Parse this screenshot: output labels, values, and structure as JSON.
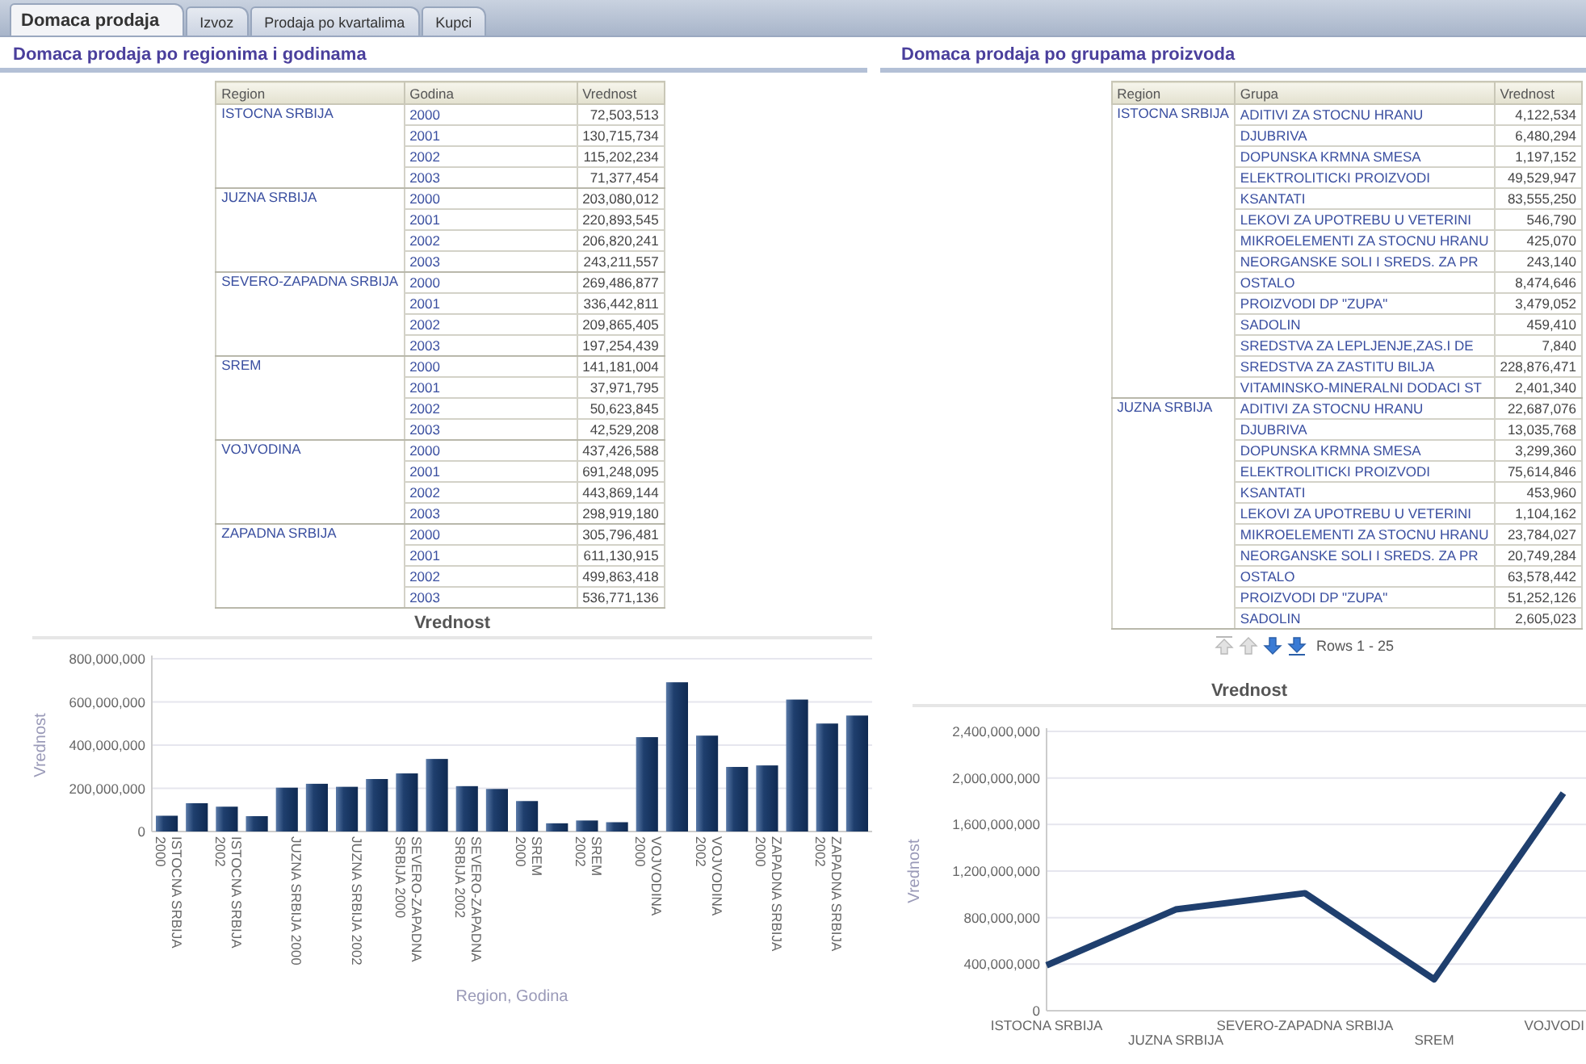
{
  "tabs": [
    {
      "label": "Domaca prodaja",
      "selected": true
    },
    {
      "label": "Izvoz",
      "selected": false
    },
    {
      "label": "Prodaja po kvartalima",
      "selected": false
    },
    {
      "label": "Kupci",
      "selected": false
    }
  ],
  "left": {
    "title": "Domaca prodaja po regionima i godinama",
    "table": {
      "columns": [
        "Region",
        "Godina",
        "Vrednost"
      ],
      "groups": [
        {
          "region": "ISTOCNA SRBIJA",
          "rows": [
            [
              "2000",
              "72,503,513"
            ],
            [
              "2001",
              "130,715,734"
            ],
            [
              "2002",
              "115,202,234"
            ],
            [
              "2003",
              "71,377,454"
            ]
          ]
        },
        {
          "region": "JUZNA SRBIJA",
          "rows": [
            [
              "2000",
              "203,080,012"
            ],
            [
              "2001",
              "220,893,545"
            ],
            [
              "2002",
              "206,820,241"
            ],
            [
              "2003",
              "243,211,557"
            ]
          ]
        },
        {
          "region": "SEVERO-ZAPADNA SRBIJA",
          "rows": [
            [
              "2000",
              "269,486,877"
            ],
            [
              "2001",
              "336,442,811"
            ],
            [
              "2002",
              "209,865,405"
            ],
            [
              "2003",
              "197,254,439"
            ]
          ]
        },
        {
          "region": "SREM",
          "rows": [
            [
              "2000",
              "141,181,004"
            ],
            [
              "2001",
              "37,971,795"
            ],
            [
              "2002",
              "50,623,845"
            ],
            [
              "2003",
              "42,529,208"
            ]
          ]
        },
        {
          "region": "VOJVODINA",
          "rows": [
            [
              "2000",
              "437,426,588"
            ],
            [
              "2001",
              "691,248,095"
            ],
            [
              "2002",
              "443,869,144"
            ],
            [
              "2003",
              "298,919,180"
            ]
          ]
        },
        {
          "region": "ZAPADNA SRBIJA",
          "rows": [
            [
              "2000",
              "305,796,481"
            ],
            [
              "2001",
              "611,130,915"
            ],
            [
              "2002",
              "499,863,418"
            ],
            [
              "2003",
              "536,771,136"
            ]
          ]
        }
      ]
    },
    "chart_data": {
      "type": "bar",
      "title": "Vrednost",
      "xlabel": "Region, Godina",
      "ylabel": "Vrednost",
      "categories": [
        "ISTOCNA SRBIJA\n2000",
        null,
        "ISTOCNA SRBIJA\n2002",
        null,
        "JUZNA SRBIJA 2000",
        null,
        "JUZNA SRBIJA 2002",
        null,
        "SEVERO-ZAPADNA\nSRBIJA 2000",
        null,
        "SEVERO-ZAPADNA\nSRBIJA 2002",
        null,
        "SREM\n2000",
        null,
        "SREM\n2002",
        null,
        "VOJVODINA\n2000",
        null,
        "VOJVODINA\n2002",
        null,
        "ZAPADNA SRBIJA\n2000",
        null,
        "ZAPADNA SRBIJA\n2002",
        null
      ],
      "series": [
        {
          "color": "#1f3f6e",
          "values": [
            73000000,
            131000000,
            115000000,
            71000000,
            203000000,
            221000000,
            207000000,
            243000000,
            269000000,
            336000000,
            210000000,
            197000000,
            141000000,
            38000000,
            51000000,
            43000000,
            437000000,
            691000000,
            444000000,
            299000000,
            306000000,
            611000000,
            500000000,
            537000000
          ]
        }
      ],
      "ylim": [
        0,
        800000000
      ],
      "grid": true,
      "yticks": [
        {
          "value": 0,
          "label": "0"
        },
        {
          "value": 200000000,
          "label": "200,000,000"
        },
        {
          "value": 400000000,
          "label": "400,000,000"
        },
        {
          "value": 600000000,
          "label": "600,000,000"
        },
        {
          "value": 800000000,
          "label": "800,000,000"
        }
      ]
    }
  },
  "right": {
    "title": "Domaca prodaja po grupama proizvoda",
    "table": {
      "columns": [
        "Region",
        "Grupa",
        "Vrednost"
      ],
      "groups": [
        {
          "region": "ISTOCNA SRBIJA",
          "rows": [
            [
              "ADITIVI ZA STOCNU HRANU",
              "4,122,534"
            ],
            [
              "DJUBRIVA",
              "6,480,294"
            ],
            [
              "DOPUNSKA KRMNA SMESA",
              "1,197,152"
            ],
            [
              "ELEKTROLITICKI PROIZVODI",
              "49,529,947"
            ],
            [
              "KSANTATI",
              "83,555,250"
            ],
            [
              "LEKOVI ZA UPOTREBU U VETERINI",
              "546,790"
            ],
            [
              "MIKROELEMENTI ZA STOCNU HRANU",
              "425,070"
            ],
            [
              "NEORGANSKE SOLI I SREDS. ZA PR",
              "243,140"
            ],
            [
              "OSTALO",
              "8,474,646"
            ],
            [
              "PROIZVODI DP \"ZUPA\"",
              "3,479,052"
            ],
            [
              "SADOLIN",
              "459,410"
            ],
            [
              "SREDSTVA ZA LEPLJENJE,ZAS.I DE",
              "7,840"
            ],
            [
              "SREDSTVA ZA ZASTITU BILJA",
              "228,876,471"
            ],
            [
              "VITAMINSKO-MINERALNI DODACI ST",
              "2,401,340"
            ]
          ]
        },
        {
          "region": "JUZNA SRBIJA",
          "rows": [
            [
              "ADITIVI ZA STOCNU HRANU",
              "22,687,076"
            ],
            [
              "DJUBRIVA",
              "13,035,768"
            ],
            [
              "DOPUNSKA KRMNA SMESA",
              "3,299,360"
            ],
            [
              "ELEKTROLITICKI PROIZVODI",
              "75,614,846"
            ],
            [
              "KSANTATI",
              "453,960"
            ],
            [
              "LEKOVI ZA UPOTREBU U VETERINI",
              "1,104,162"
            ],
            [
              "MIKROELEMENTI ZA STOCNU HRANU",
              "23,784,027"
            ],
            [
              "NEORGANSKE SOLI I SREDS. ZA PR",
              "20,749,284"
            ],
            [
              "OSTALO",
              "63,578,442"
            ],
            [
              "PROIZVODI DP \"ZUPA\"",
              "51,252,126"
            ],
            [
              "SADOLIN",
              "2,605,023"
            ]
          ]
        }
      ]
    },
    "pager": {
      "buttons": [
        {
          "kind": "first",
          "disabled": true
        },
        {
          "kind": "previous",
          "disabled": true
        },
        {
          "kind": "next",
          "disabled": false
        },
        {
          "kind": "last",
          "disabled": false
        }
      ],
      "text": "Rows 1 - 25"
    },
    "chart_data": {
      "type": "line",
      "title": "Vrednost",
      "ylabel": "Vrednost",
      "categories": [
        "ISTOCNA SRBIJA",
        "JUZNA SRBIJA",
        "SEVERO-ZAPADNA SRBIJA",
        "SREM",
        "VOJVODI"
      ],
      "series": [
        {
          "color": "#1f3f6e",
          "values": [
            390000000,
            870000000,
            1010000000,
            270000000,
            1870000000
          ]
        }
      ],
      "ylim": [
        0,
        2400000000
      ],
      "grid": true,
      "yticks": [
        {
          "value": 0,
          "label": "0"
        },
        {
          "value": 400000000,
          "label": "400,000,000"
        },
        {
          "value": 800000000,
          "label": "800,000,000"
        },
        {
          "value": 1200000000,
          "label": "1,200,000,000"
        },
        {
          "value": 1600000000,
          "label": "1,600,000,000"
        },
        {
          "value": 2000000000,
          "label": "2,000,000,000"
        },
        {
          "value": 2400000000,
          "label": "2,400,000,000"
        }
      ]
    }
  }
}
